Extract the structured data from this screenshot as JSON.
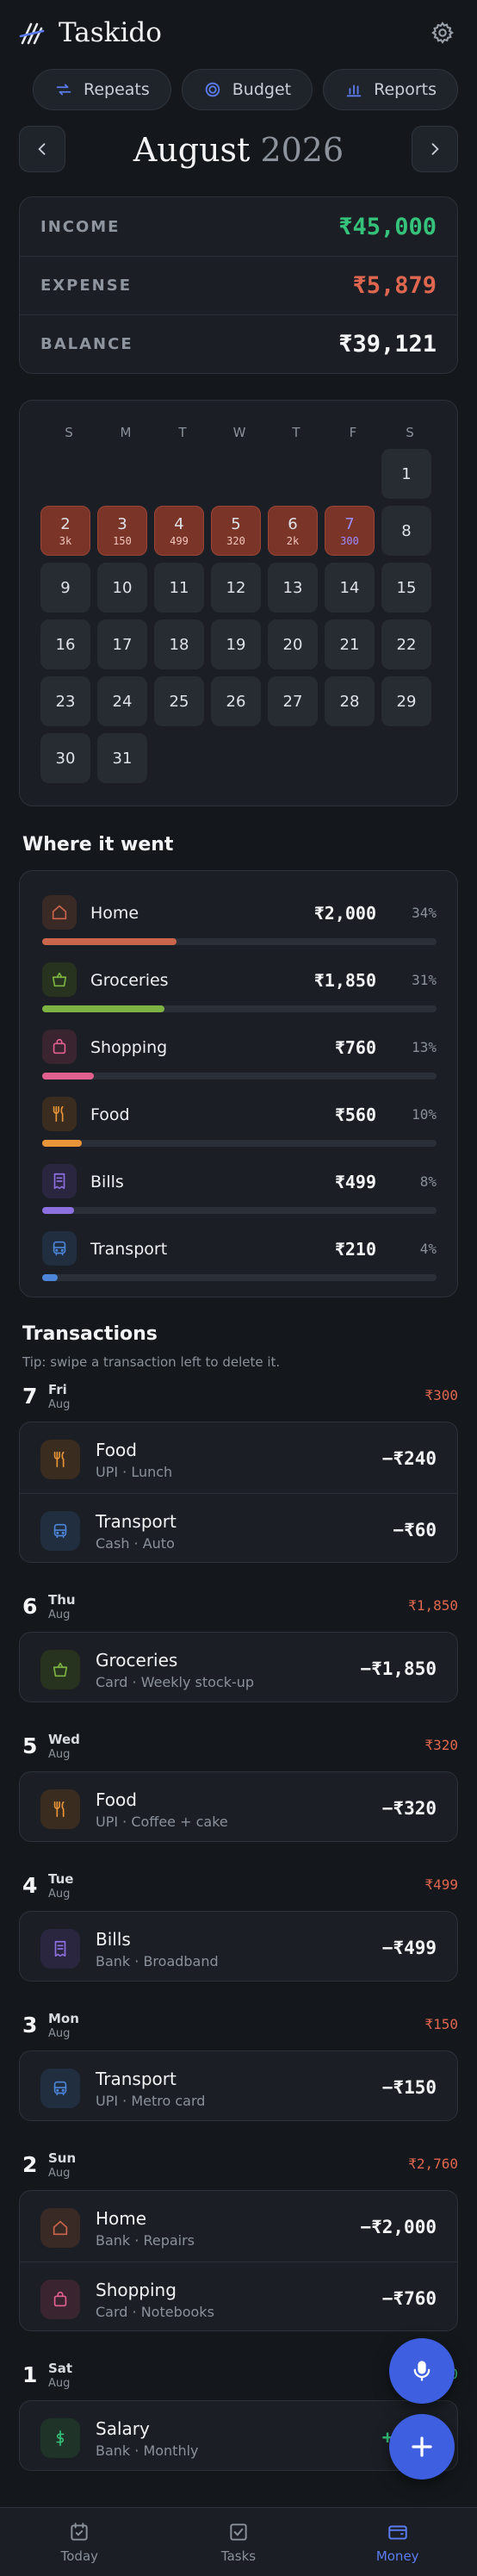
{
  "app": {
    "title": "Taskido"
  },
  "chips": [
    {
      "label": "Repeats",
      "icon": "repeat-icon"
    },
    {
      "label": "Budget",
      "icon": "budget-icon"
    },
    {
      "label": "Reports",
      "icon": "reports-icon"
    }
  ],
  "month": {
    "name": "August",
    "year": "2026"
  },
  "summary": {
    "income_label": "INCOME",
    "income_value": "₹45,000",
    "expense_label": "EXPENSE",
    "expense_value": "₹5,879",
    "balance_label": "BALANCE",
    "balance_value": "₹39,121"
  },
  "calendar": {
    "weekdays": [
      "S",
      "M",
      "T",
      "W",
      "T",
      "F",
      "S"
    ],
    "leading_blanks": 6,
    "days": [
      {
        "d": "1"
      },
      {
        "d": "2",
        "amt": "3k"
      },
      {
        "d": "3",
        "amt": "150"
      },
      {
        "d": "4",
        "amt": "499"
      },
      {
        "d": "5",
        "amt": "320"
      },
      {
        "d": "6",
        "amt": "2k"
      },
      {
        "d": "7",
        "amt": "300",
        "today": true
      },
      {
        "d": "8"
      },
      {
        "d": "9"
      },
      {
        "d": "10"
      },
      {
        "d": "11"
      },
      {
        "d": "12"
      },
      {
        "d": "13"
      },
      {
        "d": "14"
      },
      {
        "d": "15"
      },
      {
        "d": "16"
      },
      {
        "d": "17"
      },
      {
        "d": "18"
      },
      {
        "d": "19"
      },
      {
        "d": "20"
      },
      {
        "d": "21"
      },
      {
        "d": "22"
      },
      {
        "d": "23"
      },
      {
        "d": "24"
      },
      {
        "d": "25"
      },
      {
        "d": "26"
      },
      {
        "d": "27"
      },
      {
        "d": "28"
      },
      {
        "d": "29"
      },
      {
        "d": "30"
      },
      {
        "d": "31"
      }
    ]
  },
  "where": {
    "title": "Where it went",
    "categories": [
      {
        "name": "Home",
        "amount": "₹2,000",
        "pct": "34%",
        "share": 0.34,
        "color": "#c9654a",
        "bg": "#3a2a26",
        "icon": "home-icon"
      },
      {
        "name": "Groceries",
        "amount": "₹1,850",
        "pct": "31%",
        "share": 0.31,
        "color": "#7cb342",
        "bg": "#27331f",
        "icon": "basket-icon"
      },
      {
        "name": "Shopping",
        "amount": "₹760",
        "pct": "13%",
        "share": 0.13,
        "color": "#e2608e",
        "bg": "#3a2430",
        "icon": "bag-icon"
      },
      {
        "name": "Food",
        "amount": "₹560",
        "pct": "10%",
        "share": 0.1,
        "color": "#e8953a",
        "bg": "#3a2c1f",
        "icon": "utensils-icon"
      },
      {
        "name": "Bills",
        "amount": "₹499",
        "pct": "8%",
        "share": 0.08,
        "color": "#8c70e0",
        "bg": "#2b2640",
        "icon": "receipt-icon"
      },
      {
        "name": "Transport",
        "amount": "₹210",
        "pct": "4%",
        "share": 0.04,
        "color": "#4d86d8",
        "bg": "#212e40",
        "icon": "bus-icon"
      }
    ]
  },
  "transactions": {
    "title": "Transactions",
    "tip": "Tip: swipe a transaction left to delete it.",
    "days": [
      {
        "num": "7",
        "dow": "Fri",
        "mon": "Aug",
        "total": "₹300",
        "total_color": "#e0674f",
        "items": [
          {
            "name": "Food",
            "sub": "UPI  · Lunch",
            "amount": "−₹240",
            "icon": "utensils-icon",
            "color": "#e8953a",
            "bg": "#3a2c1f"
          },
          {
            "name": "Transport",
            "sub": "Cash  · Auto",
            "amount": "−₹60",
            "icon": "bus-icon",
            "color": "#4d86d8",
            "bg": "#212e40"
          }
        ]
      },
      {
        "num": "6",
        "dow": "Thu",
        "mon": "Aug",
        "total": "₹1,850",
        "total_color": "#e0674f",
        "items": [
          {
            "name": "Groceries",
            "sub": "Card  · Weekly stock-up",
            "amount": "−₹1,850",
            "icon": "basket-icon",
            "color": "#7cb342",
            "bg": "#27331f"
          }
        ]
      },
      {
        "num": "5",
        "dow": "Wed",
        "mon": "Aug",
        "total": "₹320",
        "total_color": "#e0674f",
        "items": [
          {
            "name": "Food",
            "sub": "UPI  · Coffee + cake",
            "amount": "−₹320",
            "icon": "utensils-icon",
            "color": "#e8953a",
            "bg": "#3a2c1f"
          }
        ]
      },
      {
        "num": "4",
        "dow": "Tue",
        "mon": "Aug",
        "total": "₹499",
        "total_color": "#e0674f",
        "items": [
          {
            "name": "Bills",
            "sub": "Bank  · Broadband",
            "amount": "−₹499",
            "icon": "receipt-icon",
            "color": "#8c70e0",
            "bg": "#2b2640"
          }
        ]
      },
      {
        "num": "3",
        "dow": "Mon",
        "mon": "Aug",
        "total": "₹150",
        "total_color": "#e0674f",
        "items": [
          {
            "name": "Transport",
            "sub": "UPI  · Metro card",
            "amount": "−₹150",
            "icon": "bus-icon",
            "color": "#4d86d8",
            "bg": "#212e40"
          }
        ]
      },
      {
        "num": "2",
        "dow": "Sun",
        "mon": "Aug",
        "total": "₹2,760",
        "total_color": "#e0674f",
        "items": [
          {
            "name": "Home",
            "sub": "Bank  · Repairs",
            "amount": "−₹2,000",
            "icon": "home-icon",
            "color": "#c9654a",
            "bg": "#3a2a26"
          },
          {
            "name": "Shopping",
            "sub": "Card  · Notebooks",
            "amount": "−₹760",
            "icon": "bag-icon",
            "color": "#e2608e",
            "bg": "#3a2430"
          }
        ]
      },
      {
        "num": "1",
        "dow": "Sat",
        "mon": "Aug",
        "total": "₹45,000",
        "total_color": "#35c27a",
        "items": [
          {
            "name": "Salary",
            "sub": "Bank  · Monthly",
            "amount": "+₹45,",
            "icon": "rupee-icon",
            "color": "#35c27a",
            "bg": "#1f3329",
            "income": true
          }
        ]
      }
    ]
  },
  "nav": [
    {
      "label": "Today",
      "icon": "calendar-check-icon"
    },
    {
      "label": "Tasks",
      "icon": "checkbox-icon"
    },
    {
      "label": "Money",
      "icon": "wallet-icon",
      "active": true
    }
  ],
  "colors": {
    "income": "#35c27a",
    "expense": "#e0674f",
    "accent": "#3d5fe0"
  }
}
